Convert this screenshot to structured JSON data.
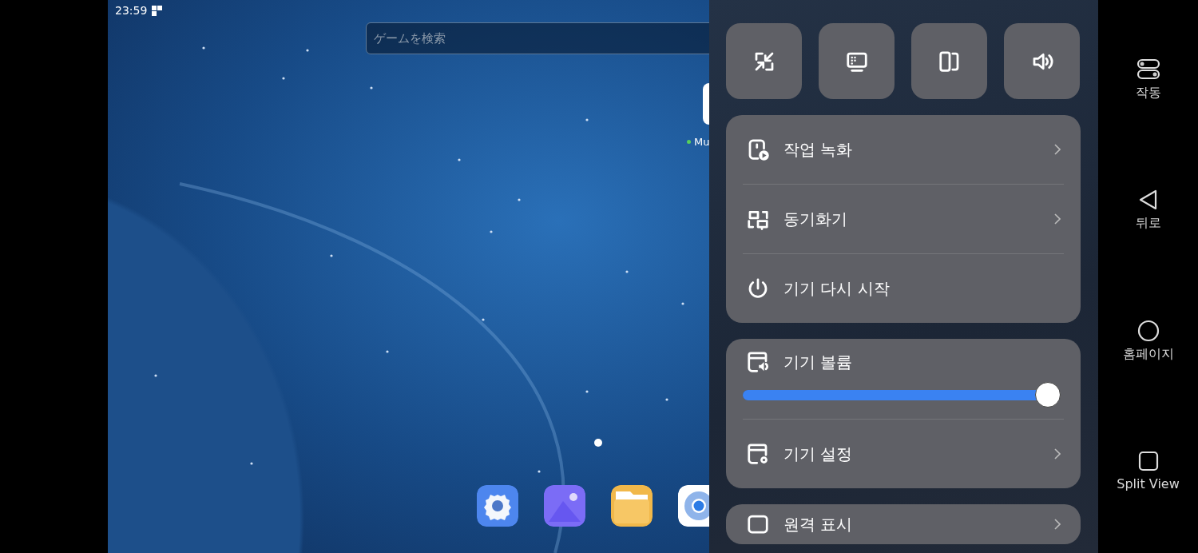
{
  "status_bar": {
    "time": "23:59"
  },
  "desktop": {
    "search": {
      "placeholder": "ゲームを検索"
    },
    "app_label": "Mu",
    "dock": [
      {
        "kind": "settings"
      },
      {
        "kind": "gallery"
      },
      {
        "kind": "files"
      },
      {
        "kind": "browser"
      }
    ]
  },
  "quick_buttons": [
    {
      "kind": "shrink"
    },
    {
      "kind": "display"
    },
    {
      "kind": "rotate"
    },
    {
      "kind": "volume"
    }
  ],
  "cards": [
    {
      "items": [
        {
          "kind": "link",
          "label": "작업 녹화"
        },
        {
          "kind": "link",
          "label": "동기화기"
        },
        {
          "kind": "action",
          "label": "기기 다시 시작"
        }
      ]
    },
    {
      "items": [
        {
          "kind": "slider",
          "label": "기기 볼륨",
          "level": 1
        },
        {
          "kind": "link",
          "label": "기기 설정"
        }
      ]
    },
    {
      "items": [
        {
          "kind": "link",
          "label": "원격 표시"
        }
      ]
    }
  ],
  "nav": [
    {
      "kind": "toggle",
      "label": "작동"
    },
    {
      "kind": "back",
      "label": "뒤로"
    },
    {
      "kind": "home",
      "label": "홈페이지"
    },
    {
      "kind": "square",
      "label": "Split View"
    }
  ]
}
